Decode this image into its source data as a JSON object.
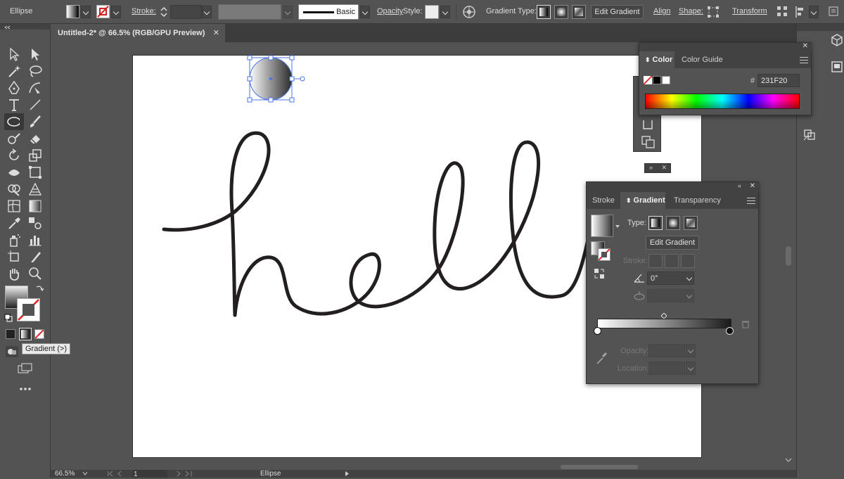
{
  "control_bar": {
    "object_type": "Ellipse",
    "stroke_label": "Stroke:",
    "brush_label": "Basic",
    "opacity_label": "Opacity",
    "style_label": "Style:",
    "gradient_type_label": "Gradient Type:",
    "edit_gradient_label": "Edit Gradient",
    "align_label": "Align",
    "shape_label": "Shape:",
    "transform_label": "Transform"
  },
  "document_tab": {
    "title": "Untitled-2* @ 66.5% (RGB/GPU Preview)",
    "close": "✕"
  },
  "tooltip": {
    "text": "Gradient (>)"
  },
  "canvas": {
    "artwork_text": "hello"
  },
  "color_panel": {
    "tabs": [
      "Color",
      "Color Guide"
    ],
    "hex_prefix": "#",
    "hex_value": "231F20"
  },
  "gradient_panel": {
    "tabs": [
      "Stroke",
      "Gradient",
      "Transparency"
    ],
    "type_label": "Type:",
    "edit_gradient_label": "Edit Gradient",
    "stroke_label": "Stroke:",
    "angle_value": "0°",
    "opacity_label": "Opacity:",
    "location_label": "Location:"
  },
  "status_bar": {
    "zoom": "66.5%",
    "artboard_number": "1",
    "tool_name": "Ellipse"
  },
  "colors": {
    "ui_bg": "#535353",
    "panel_header": "#424242",
    "selection_blue": "#4a74e0",
    "stroke_black": "#231F20"
  }
}
